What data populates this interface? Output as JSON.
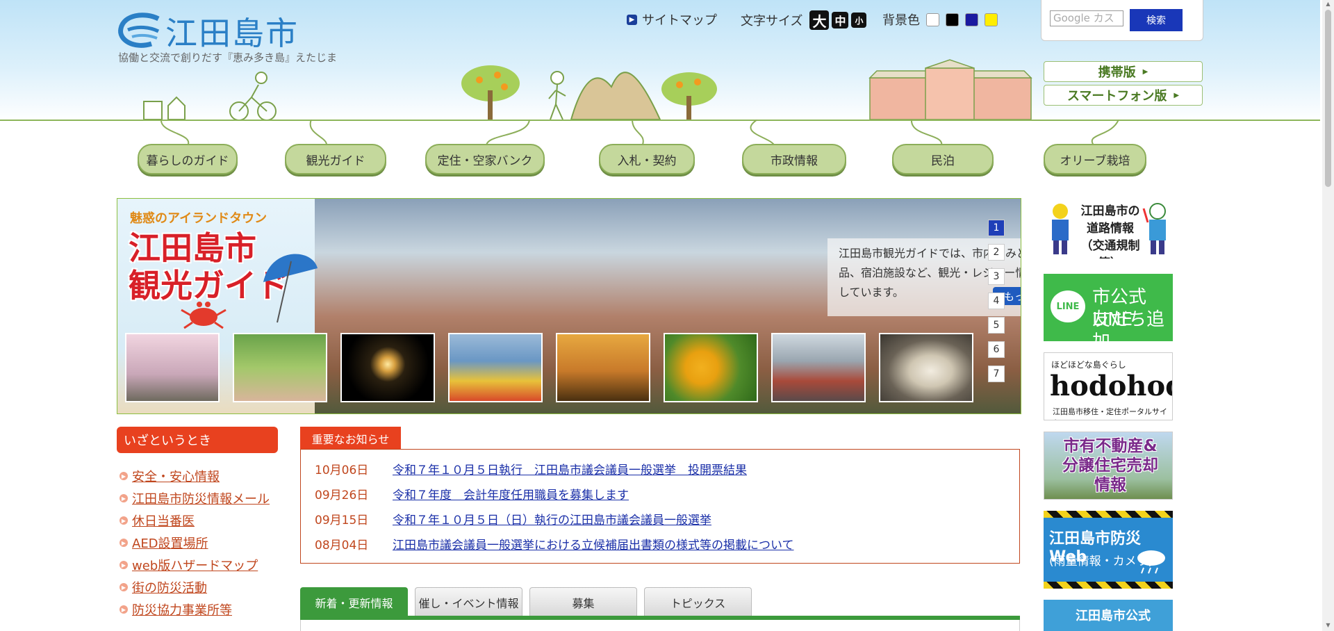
{
  "site": {
    "name": "江田島市",
    "tagline": "協働と交流で創りだす『恵み多き島』えたじま"
  },
  "utility": {
    "sitemap": "サイトマップ",
    "font_size_label": "文字サイズ",
    "font_sizes": [
      "大",
      "中",
      "小"
    ],
    "bg_color_label": "背景色",
    "bg_colors": [
      "#ffffff",
      "#000000",
      "#1a1aa0",
      "#ffee00"
    ]
  },
  "search": {
    "placeholder": "Google カスタ",
    "button": "検索"
  },
  "versions": {
    "mobile": "携帯版",
    "smartphone": "スマートフォン版"
  },
  "nav": [
    "暮らしのガイド",
    "観光ガイド",
    "定住・空家バンク",
    "入札・契約",
    "市政情報",
    "民泊",
    "オリーブ栽培"
  ],
  "hero": {
    "promo_sub": "魅惑のアイランドタウン",
    "promo_title_line1": "江田島市",
    "promo_title_line2": "観光ガイド",
    "caption": "江田島市観光ガイドでは、市内のみどころや特産品、宿泊施設など、観光・レジャー情報をご紹介しています。",
    "more": "もっと見る",
    "slides": [
      "1",
      "2",
      "3",
      "4",
      "5",
      "6",
      "7"
    ],
    "active_slide": "1"
  },
  "right_banners": {
    "road": "江田島市の道路情報（交通規制等）",
    "line_title": "市公式LINE",
    "line_sub": "友だち追加",
    "line_logo": "LINE",
    "hodohodo_sub": "ほどほどな島ぐらし",
    "hodohodo": "hodohodo",
    "hodohodo_caption": "江田島市移住・定住ポータルサイト",
    "realestate": "市有不動産&分譲住宅売却情報",
    "bousai_web": "江田島市防災Web",
    "bousai_sub": "(雨量情報・カメラ)",
    "official": "江田島市公式"
  },
  "emergency": {
    "heading": "いざというとき",
    "items": [
      "安全・安心情報",
      "江田島市防災情報メール",
      "休日当番医",
      "AED設置場所",
      "web版ハザードマップ",
      "街の防災活動",
      "防災協力事業所等"
    ]
  },
  "notices": {
    "heading": "重要なお知らせ",
    "items": [
      {
        "date": "10月06日",
        "title": "令和７年１０月５日執行　江田島市議会議員一般選挙　投開票結果"
      },
      {
        "date": "09月26日",
        "title": "令和７年度　会計年度任用職員を募集します"
      },
      {
        "date": "09月15日",
        "title": "令和７年１０月５日（日）執行の江田島市議会議員一般選挙"
      },
      {
        "date": "08月04日",
        "title": "江田島市議会議員一般選挙における立候補届出書類の様式等の掲載について"
      }
    ]
  },
  "tabs": [
    "新着・更新情報",
    "催し・イベント情報",
    "募集",
    "トピックス"
  ]
}
